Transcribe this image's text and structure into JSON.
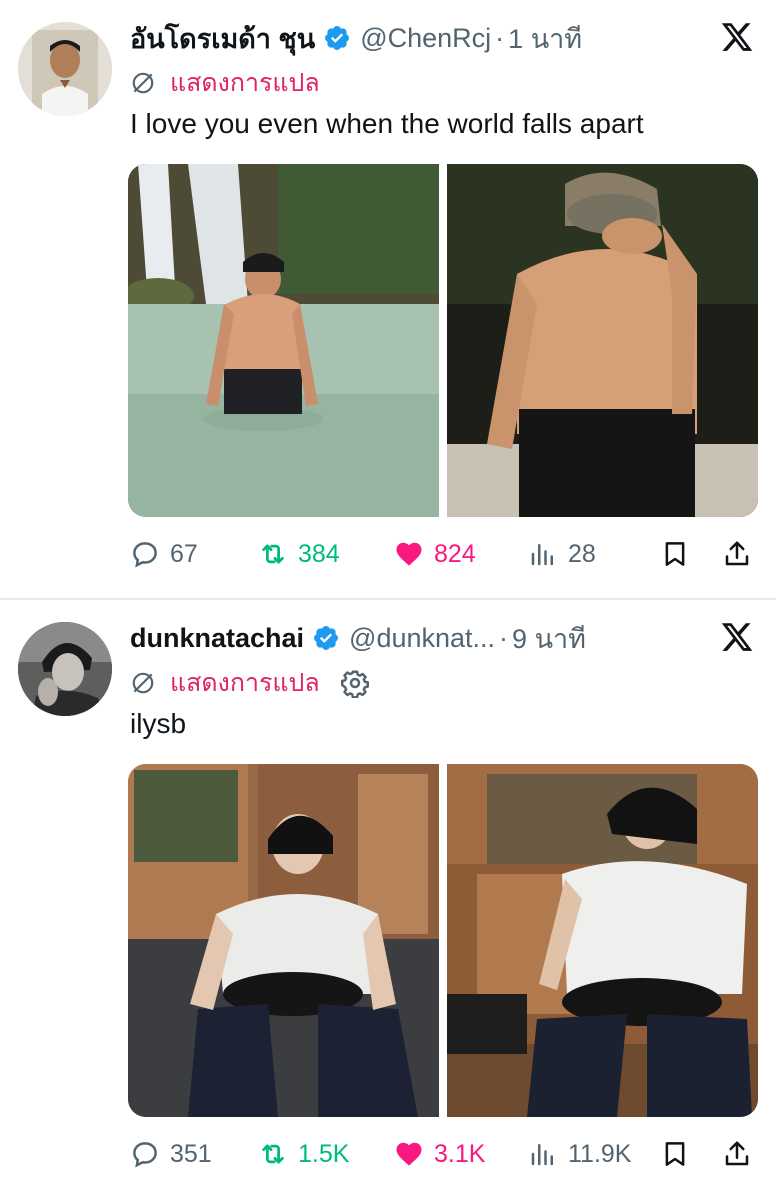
{
  "tweets": [
    {
      "display_name": "อันโดรเมด้า ชุน",
      "handle": "@ChenRcj",
      "separator": "·",
      "time": "1 นาที",
      "translate_label": "แสดงการแปล",
      "text": "I love you even when the world falls apart",
      "stats": {
        "replies": "67",
        "retweets": "384",
        "likes": "824",
        "views": "28"
      }
    },
    {
      "display_name": "dunknatachai",
      "handle": "@dunknat...",
      "separator": "·",
      "time": "9 นาที",
      "translate_label": "แสดงการแปล",
      "text": "ilysb",
      "stats": {
        "replies": "351",
        "retweets": "1.5K",
        "likes": "3.1K",
        "views": "11.9K"
      }
    }
  ],
  "colors": {
    "verified": "#1d9bf0",
    "retweet_active": "#00ba7c",
    "like_active": "#f91880",
    "translate_link": "#e0245e",
    "muted": "#536471"
  },
  "icons": [
    "verified-badge-icon",
    "x-logo-icon",
    "translate-icon",
    "gear-icon",
    "reply-icon",
    "retweet-icon",
    "like-icon",
    "views-icon",
    "bookmark-icon",
    "share-icon"
  ]
}
